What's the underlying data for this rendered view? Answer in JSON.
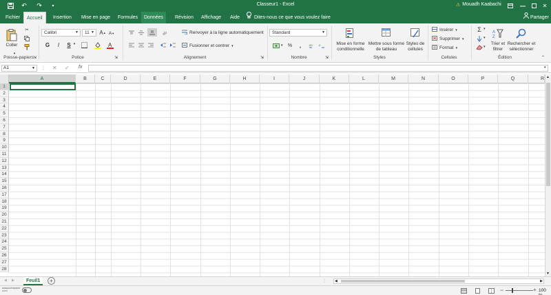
{
  "titlebar": {
    "doc_title": "Classeur1  -  Excel",
    "user_name": "Mouadh Kaabachi",
    "warn_icon": "⚠"
  },
  "tabs": [
    "Fichier",
    "Accueil",
    "Insertion",
    "Mise en page",
    "Formules",
    "Données",
    "Révision",
    "Affichage",
    "Aide"
  ],
  "tellme": "Dites-nous ce que vous voulez faire",
  "share": "Partager",
  "ribbon": {
    "clipboard": {
      "paste": "Coller",
      "label": "Presse-papiers"
    },
    "font": {
      "name": "Calibri",
      "size": "11",
      "bold": "G",
      "italic": "I",
      "underline": "S",
      "grow": "A",
      "shrink": "A",
      "label": "Police"
    },
    "alignment": {
      "wrap": "Renvoyer à la ligne automatiquement",
      "merge": "Fusionner et centrer",
      "label": "Alignement"
    },
    "number": {
      "format": "Standard",
      "percent": "%",
      "thousands": "000",
      "label": "Nombre"
    },
    "styles": {
      "cond1": "Mise en forme",
      "cond2": "conditionnelle",
      "table1": "Mettre sous forme",
      "table2": "de tableau",
      "cell1": "Styles de",
      "cell2": "cellules",
      "label": "Styles"
    },
    "cells": {
      "insert": "Insérer",
      "delete": "Supprimer",
      "format": "Format",
      "label": "Cellules"
    },
    "editing": {
      "sort1": "Trier et",
      "sort2": "filtrer",
      "find1": "Rechercher et",
      "find2": "sélectionner",
      "label": "Édition"
    }
  },
  "formula_bar": {
    "namebox": "A1",
    "fx": "fx",
    "value": ""
  },
  "columns": [
    "A",
    "B",
    "C",
    "D",
    "E",
    "F",
    "G",
    "H",
    "I",
    "J",
    "K",
    "L",
    "M",
    "N",
    "O",
    "P",
    "Q",
    "R"
  ],
  "rows": [
    "1",
    "2",
    "3",
    "4",
    "5",
    "6",
    "7",
    "8",
    "9",
    "10",
    "11",
    "12",
    "13",
    "14",
    "15",
    "16",
    "17",
    "18",
    "19",
    "20",
    "21",
    "22",
    "23",
    "24",
    "25",
    "26",
    "27",
    "28"
  ],
  "sheet_tab": "Feuil1",
  "status": {
    "zoom": "100 %",
    "left_text": "ENREGISTREMENT AUTO"
  },
  "colors": {
    "brand": "#217346",
    "ribbon_bg": "#f3f3f3"
  }
}
